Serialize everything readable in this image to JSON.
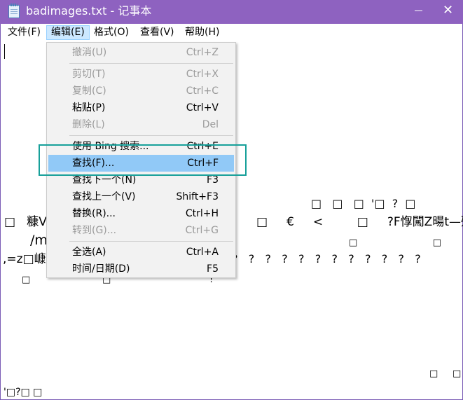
{
  "window": {
    "title": "badimages.txt - 记事本",
    "close_glyph": "✕"
  },
  "menubar": {
    "items": [
      {
        "label": "文件(F)"
      },
      {
        "label": "编辑(E)"
      },
      {
        "label": "格式(O)"
      },
      {
        "label": "查看(V)"
      },
      {
        "label": "帮助(H)"
      }
    ]
  },
  "edit_menu": {
    "items": [
      {
        "label": "撤消(U)",
        "shortcut": "Ctrl+Z",
        "enabled": false
      },
      {
        "label": "剪切(T)",
        "shortcut": "Ctrl+X",
        "enabled": false
      },
      {
        "label": "复制(C)",
        "shortcut": "Ctrl+C",
        "enabled": false
      },
      {
        "label": "粘贴(P)",
        "shortcut": "Ctrl+V",
        "enabled": true
      },
      {
        "label": "删除(L)",
        "shortcut": "Del",
        "enabled": false
      },
      {
        "label": "使用 Bing 搜索...",
        "shortcut": "Ctrl+E",
        "enabled": true
      },
      {
        "label": "查找(F)...",
        "shortcut": "Ctrl+F",
        "enabled": true,
        "highlighted": true
      },
      {
        "label": "查找下一个(N)",
        "shortcut": "F3",
        "enabled": true
      },
      {
        "label": "查找上一个(V)",
        "shortcut": "Shift+F3",
        "enabled": true
      },
      {
        "label": "替换(R)...",
        "shortcut": "Ctrl+H",
        "enabled": true
      },
      {
        "label": "转到(G)...",
        "shortcut": "Ctrl+G",
        "enabled": false
      },
      {
        "label": "全选(A)",
        "shortcut": "Ctrl+A",
        "enabled": true
      },
      {
        "label": "时间/日期(D)",
        "shortcut": "F5",
        "enabled": true
      }
    ]
  },
  "editor": {
    "lines": [
      "□   □   □  '□  ?  □",
      "□   糠V",
      "□     €     <         □     ?F惸闖Z暘t—殌",
      "/m",
      "□                          □",
      ",=z□嵻",
      "?   ?   ?   ?   ?   ?   ?   ?   ?   ?   ?   ?",
      "□",
      "□",
      "!",
      "□     □",
      "'□?□ □"
    ]
  },
  "colors": {
    "titlebar": "#8e62c0",
    "menu_highlight": "#91c9f7",
    "annotation": "#17a09a"
  }
}
